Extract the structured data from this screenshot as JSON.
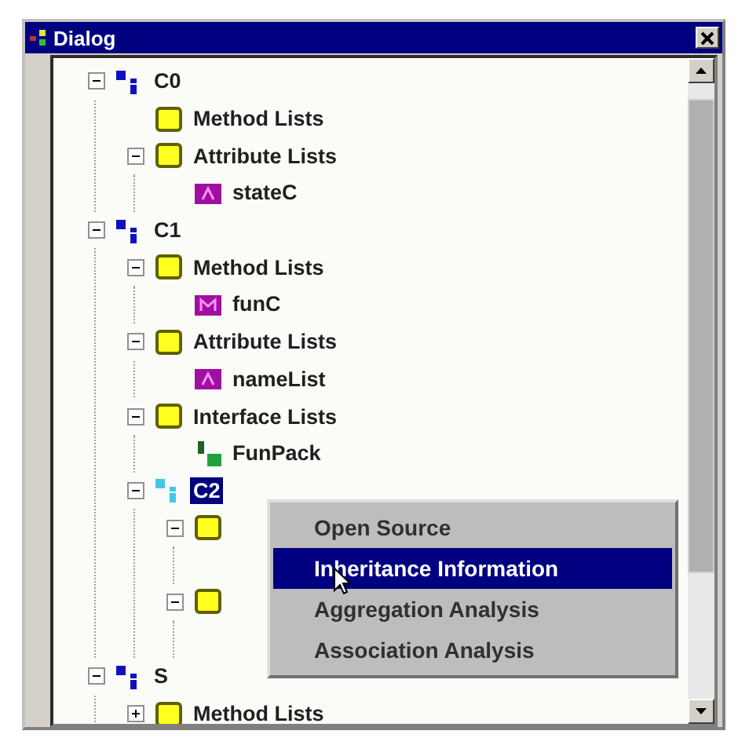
{
  "window": {
    "title": "Dialog"
  },
  "tree": [
    {
      "kind": "class",
      "label": "C0",
      "expanded": true,
      "selected": false,
      "children": [
        {
          "kind": "folder",
          "label": "Method Lists",
          "selected": false
        },
        {
          "kind": "folder",
          "label": "Attribute Lists",
          "expanded": true,
          "selected": false,
          "children": [
            {
              "kind": "attribute",
              "label": "stateC",
              "selected": false
            }
          ]
        }
      ]
    },
    {
      "kind": "class",
      "label": "C1",
      "expanded": true,
      "selected": false,
      "children": [
        {
          "kind": "folder",
          "label": "Method Lists",
          "expanded": true,
          "selected": false,
          "children": [
            {
              "kind": "method",
              "label": "funC",
              "selected": false
            }
          ]
        },
        {
          "kind": "folder",
          "label": "Attribute Lists",
          "expanded": true,
          "selected": false,
          "children": [
            {
              "kind": "attribute",
              "label": "nameList",
              "selected": false
            }
          ]
        },
        {
          "kind": "folder",
          "label": "Interface Lists",
          "expanded": true,
          "selected": false,
          "children": [
            {
              "kind": "interface",
              "label": "FunPack",
              "selected": false
            }
          ]
        },
        {
          "kind": "class",
          "label": "C2",
          "expanded": true,
          "selected": true,
          "children": [
            {
              "kind": "folder",
              "expanded": true,
              "selected": false
            },
            {
              "kind": "folder",
              "expanded": true,
              "selected": false
            }
          ]
        }
      ]
    },
    {
      "kind": "class",
      "label": "S",
      "expanded": true,
      "selected": false,
      "children": [
        {
          "kind": "folder",
          "label": "Method Lists",
          "expanded": false,
          "selected": false
        }
      ]
    }
  ],
  "context_menu": [
    {
      "label": "Open Source",
      "selected": false
    },
    {
      "label": "Inheritance Information",
      "selected": true
    },
    {
      "label": "Aggregation Analysis",
      "selected": false
    },
    {
      "label": "Association Analysis",
      "selected": false
    }
  ]
}
